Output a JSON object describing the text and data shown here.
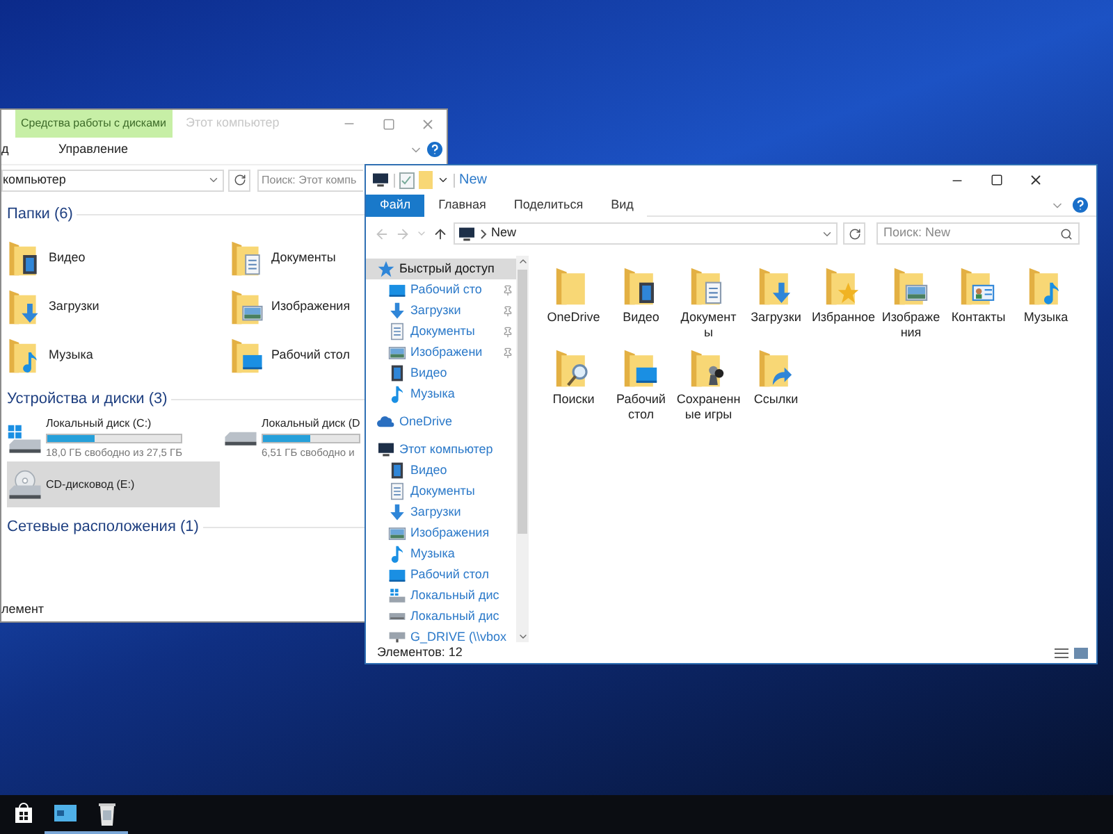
{
  "back_window": {
    "context_tab": "Средства работы с дисками",
    "title": "Этот компьютер",
    "tabs": [
      {
        "label": "д",
        "selected": false
      },
      {
        "label": "Управление",
        "selected": false
      }
    ],
    "address": "компьютер",
    "search_placeholder": "Поиск: Этот компь",
    "groups": [
      {
        "title": "Папки (6)",
        "kind": "folders",
        "items": [
          {
            "label": "Видео",
            "kind": "video"
          },
          {
            "label": "Документы",
            "kind": "documents"
          },
          {
            "label": "Загрузки",
            "kind": "downloads"
          },
          {
            "label": "Изображения",
            "kind": "pictures"
          },
          {
            "label": "Музыка",
            "kind": "music"
          },
          {
            "label": "Рабочий стол",
            "kind": "desktop"
          }
        ]
      },
      {
        "title": "Устройства и диски (3)",
        "kind": "drives",
        "items": [
          {
            "label": "Локальный диск (C:)",
            "kind": "system",
            "level": 0.35,
            "free": "18,0 ГБ свободно из 27,5 ГБ",
            "selected": false
          },
          {
            "label": "Локальный диск (D",
            "kind": "hdd",
            "level": 0.5,
            "free": "6,51 ГБ свободно и",
            "selected": false
          },
          {
            "label": "CD-дисковод (E:)",
            "kind": "cd",
            "selected": true
          }
        ]
      },
      {
        "title": "Сетевые расположения (1)",
        "kind": "network"
      }
    ],
    "status_bar": "лемент"
  },
  "front_window": {
    "title": "New",
    "tabs": [
      {
        "label": "Файл",
        "selected": true
      },
      {
        "label": "Главная",
        "selected": false
      },
      {
        "label": "Поделиться",
        "selected": false
      },
      {
        "label": "Вид",
        "selected": false
      }
    ],
    "address": "New",
    "search_placeholder": "Поиск: New",
    "navigation": [
      {
        "label": "Быстрый доступ",
        "kind": "star",
        "selected": true,
        "children": [
          {
            "label": "Рабочий сто",
            "kind": "desktop",
            "pinned": true,
            "selected": false
          },
          {
            "label": "Загрузки",
            "kind": "downloads",
            "pinned": true,
            "selected": false
          },
          {
            "label": "Документы",
            "kind": "documents",
            "pinned": true,
            "selected": false
          },
          {
            "label": "Изображени",
            "kind": "pictures",
            "pinned": true,
            "selected": false
          },
          {
            "label": "Видео",
            "kind": "video",
            "pinned": false,
            "selected": false
          },
          {
            "label": "Музыка",
            "kind": "music",
            "pinned": false,
            "selected": false
          }
        ]
      },
      {
        "label": "OneDrive",
        "kind": "cloud",
        "selected": false
      },
      {
        "label": "Этот компьютер",
        "kind": "computer",
        "selected": false,
        "children": [
          {
            "label": "Видео",
            "kind": "video",
            "pinned": false,
            "selected": false
          },
          {
            "label": "Документы",
            "kind": "documents",
            "pinned": false,
            "selected": false
          },
          {
            "label": "Загрузки",
            "kind": "downloads",
            "pinned": false,
            "selected": false
          },
          {
            "label": "Изображения",
            "kind": "pictures",
            "pinned": false,
            "selected": false
          },
          {
            "label": "Музыка",
            "kind": "music",
            "pinned": false,
            "selected": false
          },
          {
            "label": "Рабочий стол",
            "kind": "desktop",
            "pinned": false,
            "selected": false
          },
          {
            "label": "Локальный дис",
            "kind": "system",
            "pinned": false,
            "selected": false
          },
          {
            "label": "Локальный дис",
            "kind": "hdd",
            "pinned": false,
            "selected": false
          },
          {
            "label": "G_DRIVE (\\\\vbox",
            "kind": "netdrive",
            "pinned": false,
            "selected": false
          }
        ]
      }
    ],
    "items": [
      {
        "label": "OneDrive",
        "kind": "onedrive"
      },
      {
        "label": "Видео",
        "kind": "video"
      },
      {
        "label": "Документы",
        "kind": "documents"
      },
      {
        "label": "Загрузки",
        "kind": "downloads"
      },
      {
        "label": "Избранное",
        "kind": "favorites"
      },
      {
        "label": "Изображения",
        "kind": "pictures"
      },
      {
        "label": "Контакты",
        "kind": "contacts"
      },
      {
        "label": "Музыка",
        "kind": "music"
      },
      {
        "label": "Поиски",
        "kind": "searches"
      },
      {
        "label": "Рабочий стол",
        "kind": "desktop"
      },
      {
        "label": "Сохраненные игры",
        "kind": "games"
      },
      {
        "label": "Ссылки",
        "kind": "links"
      }
    ],
    "status_bar": "Элементов: 12"
  },
  "taskbar": {
    "items": [
      {
        "kind": "store",
        "running": false
      },
      {
        "kind": "explorer",
        "running": true
      },
      {
        "kind": "recycle",
        "running": true
      }
    ]
  }
}
